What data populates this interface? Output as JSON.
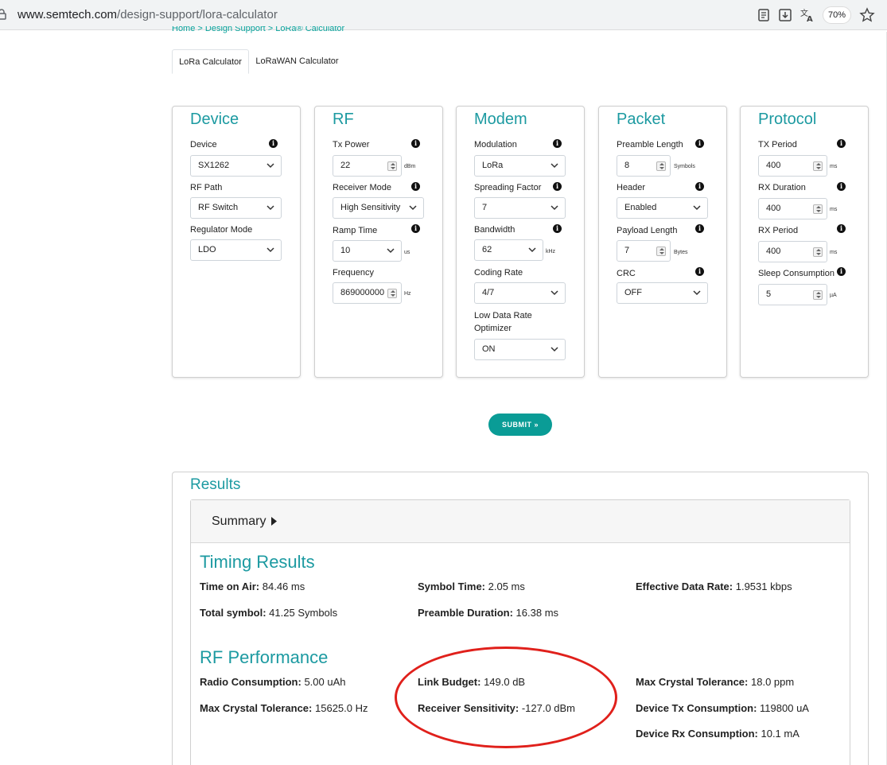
{
  "browser": {
    "url_host": "www.semtech.com",
    "url_path": "/design-support/lora-calculator",
    "zoom": "70%"
  },
  "breadcrumb": "Home  >  Design Support  >  LoRa® Calculator",
  "tabs": [
    "LoRa Calculator",
    "LoRaWAN Calculator"
  ],
  "cards": {
    "device": {
      "title": "Device",
      "device_label": "Device",
      "device_value": "SX1262",
      "rfpath_label": "RF Path",
      "rfpath_value": "RF Switch",
      "regmode_label": "Regulator Mode",
      "regmode_value": "LDO"
    },
    "rf": {
      "title": "RF",
      "txpower_label": "Tx Power",
      "txpower_value": "22",
      "txpower_unit": "dBm",
      "rxmode_label": "Receiver Mode",
      "rxmode_value": "High Sensitivity",
      "ramp_label": "Ramp Time",
      "ramp_value": "10",
      "ramp_unit": "us",
      "freq_label": "Frequency",
      "freq_value": "869000000",
      "freq_unit": "Hz"
    },
    "modem": {
      "title": "Modem",
      "mod_label": "Modulation",
      "mod_value": "LoRa",
      "sf_label": "Spreading Factor",
      "sf_value": "7",
      "bw_label": "Bandwidth",
      "bw_value": "62",
      "bw_unit": "kHz",
      "cr_label": "Coding Rate",
      "cr_value": "4/7",
      "ldro_label_1": "Low Data Rate",
      "ldro_label_2": "Optimizer",
      "ldro_value": "ON"
    },
    "packet": {
      "title": "Packet",
      "preamble_label": "Preamble Length",
      "preamble_value": "8",
      "preamble_unit": "Symbols",
      "header_label": "Header",
      "header_value": "Enabled",
      "payload_label": "Payload Length",
      "payload_value": "7",
      "payload_unit": "Bytes",
      "crc_label": "CRC",
      "crc_value": "OFF"
    },
    "protocol": {
      "title": "Protocol",
      "txperiod_label": "TX Period",
      "txperiod_value": "400",
      "txperiod_unit": "ms",
      "rxduration_label": "RX Duration",
      "rxduration_value": "400",
      "rxduration_unit": "ms",
      "rxperiod_label": "RX Period",
      "rxperiod_value": "400",
      "rxperiod_unit": "ms",
      "sleep_label": "Sleep Consumption",
      "sleep_value": "5",
      "sleep_unit": "µA"
    }
  },
  "submit_label": "SUBMIT »",
  "results": {
    "title": "Results",
    "summary_label": "Summary",
    "timing_title": "Timing Results",
    "timing": [
      {
        "label": "Time on Air:",
        "value": "84.46 ms"
      },
      {
        "label": "Symbol Time:",
        "value": "2.05 ms"
      },
      {
        "label": "Effective Data Rate:",
        "value": "1.9531 kbps"
      },
      {
        "label": "Total symbol:",
        "value": "41.25 Symbols"
      },
      {
        "label": "Preamble Duration:",
        "value": "16.38 ms"
      }
    ],
    "rf_title": "RF Performance",
    "rf": [
      {
        "label": "Radio Consumption:",
        "value": "5.00 uAh"
      },
      {
        "label": "Link Budget:",
        "value": "149.0 dB"
      },
      {
        "label": "Max Crystal Tolerance:",
        "value": "18.0 ppm"
      },
      {
        "label": "Max Crystal Tolerance:",
        "value": "15625.0 Hz"
      },
      {
        "label": "Receiver Sensitivity:",
        "value": "-127.0 dBm"
      },
      {
        "label": "Device Tx Consumption:",
        "value": "119800 uA"
      },
      {
        "label": "Device Rx Consumption:",
        "value": "10.1 mA"
      }
    ]
  },
  "colors": {
    "accent": "#1c9aa1",
    "button": "#0a9c96",
    "annotation": "#e0201b"
  }
}
